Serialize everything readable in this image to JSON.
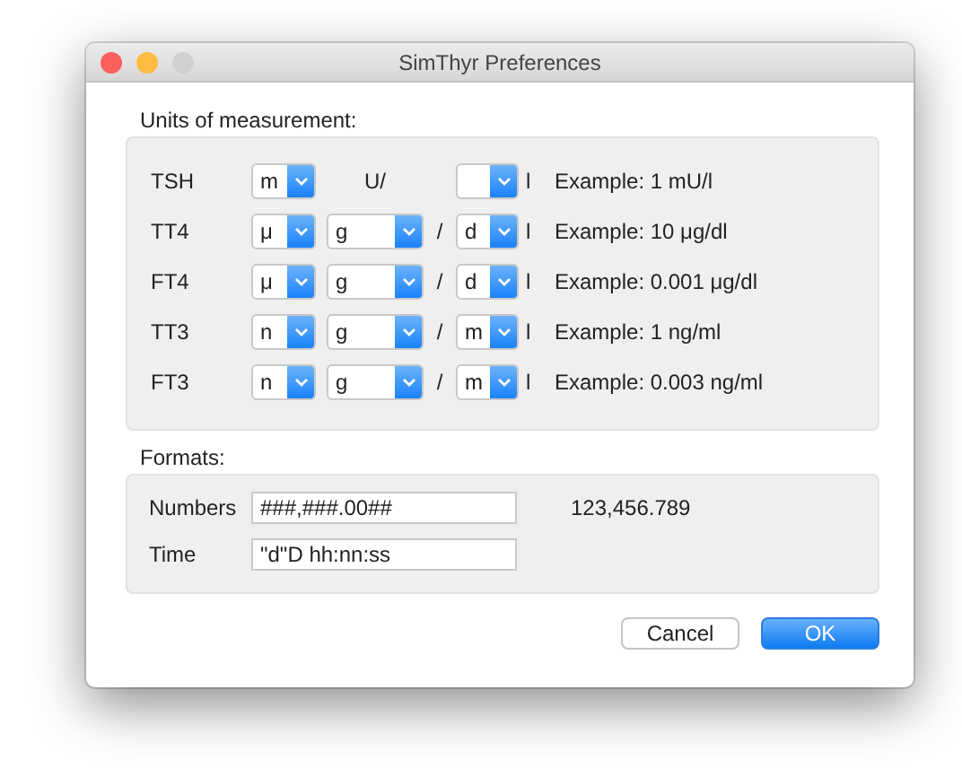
{
  "window": {
    "title": "SimThyr Preferences"
  },
  "units": {
    "heading": "Units of measurement:",
    "rows": [
      {
        "kind": "unit",
        "name": "TSH",
        "prefix": "m",
        "unit": "U/",
        "suffix": "l",
        "example": "Example: 1 mU/l"
      },
      {
        "kind": "mass",
        "name": "TT4",
        "prefix": "μ",
        "unit": "g",
        "separator": "/",
        "volume": "d",
        "suffix": "l",
        "example": "Example: 10 μg/dl"
      },
      {
        "kind": "mass",
        "name": "FT4",
        "prefix": "μ",
        "unit": "g",
        "separator": "/",
        "volume": "d",
        "suffix": "l",
        "example": "Example: 0.001 μg/dl"
      },
      {
        "kind": "mass",
        "name": "TT3",
        "prefix": "n",
        "unit": "g",
        "separator": "/",
        "volume": "m",
        "suffix": "l",
        "example": "Example: 1 ng/ml"
      },
      {
        "kind": "mass",
        "name": "FT3",
        "prefix": "n",
        "unit": "g",
        "separator": "/",
        "volume": "m",
        "suffix": "l",
        "example": "Example: 0.003 ng/ml"
      }
    ]
  },
  "formats": {
    "heading": "Formats:",
    "fields": [
      {
        "label": "Numbers",
        "value": "###,###.00##",
        "sample": "123,456.789"
      },
      {
        "label": "Time",
        "value": "\"d\"D hh:nn:ss"
      }
    ]
  },
  "buttons": [
    {
      "label": "Cancel",
      "kind": "secondary"
    },
    {
      "label": "OK",
      "kind": "primary"
    }
  ]
}
